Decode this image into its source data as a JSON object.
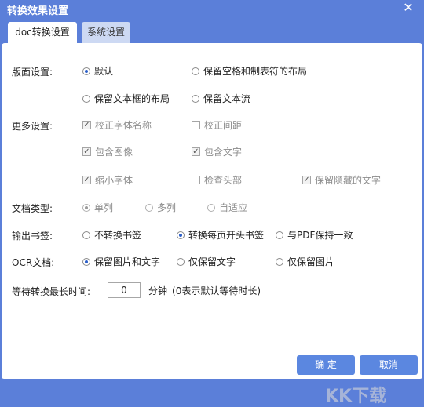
{
  "window": {
    "title": "转换效果设置",
    "close": "✕"
  },
  "tabs": [
    {
      "label": "doc转换设置",
      "active": true
    },
    {
      "label": "系统设置",
      "active": false
    }
  ],
  "layout_settings": {
    "label": "版面设置:",
    "options": [
      "默认",
      "保留空格和制表符的布局",
      "保留文本框的布局",
      "保留文本流"
    ],
    "selected": "默认"
  },
  "more_settings": {
    "label": "更多设置:",
    "options": [
      {
        "label": "校正字体名称",
        "checked": true,
        "disabled": true
      },
      {
        "label": "校正间距",
        "checked": false,
        "disabled": true
      },
      {
        "label": "包含图像",
        "checked": true,
        "disabled": true
      },
      {
        "label": "包含文字",
        "checked": true,
        "disabled": true
      },
      {
        "label": "缩小字体",
        "checked": true,
        "disabled": true
      },
      {
        "label": "检查头部",
        "checked": false,
        "disabled": true
      },
      {
        "label": "保留隐藏的文字",
        "checked": true,
        "disabled": true
      }
    ]
  },
  "doc_type": {
    "label": "文档类型:",
    "options": [
      "单列",
      "多列",
      "自适应"
    ],
    "selected": "单列"
  },
  "bookmark": {
    "label": "输出书签:",
    "options": [
      "不转换书签",
      "转换每页开头书签",
      "与PDF保持一致"
    ],
    "selected": "转换每页开头书签"
  },
  "ocr": {
    "label": "OCR文档:",
    "options": [
      "保留图片和文字",
      "仅保留文字",
      "仅保留图片"
    ],
    "selected": "保留图片和文字"
  },
  "timeout": {
    "label": "等待转换最长时间:",
    "value": "0",
    "unit": "分钟",
    "note": "(0表示默认等待时长)"
  },
  "buttons": {
    "ok": "确 定",
    "cancel": "取消"
  },
  "watermark": "KK下载",
  "colors": {
    "titlebar": "#5b7fd9",
    "button": "#5b87e0",
    "radio_selected": "#2c5fc8"
  }
}
